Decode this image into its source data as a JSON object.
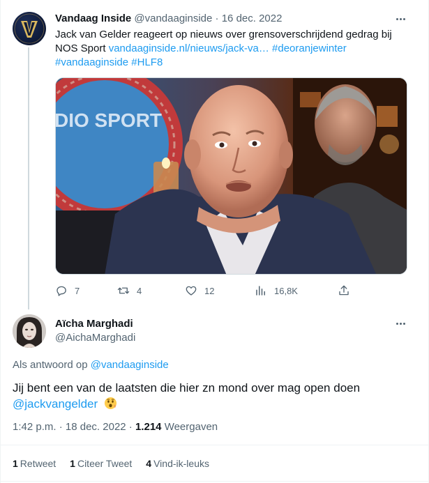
{
  "original_tweet": {
    "display_name": "Vandaag Inside",
    "handle": "@vandaaginside",
    "separator": " · ",
    "date": "16 dec. 2022",
    "text_plain": "Jack van Gelder reageert op nieuws over grensoverschrijdend gedrag bij NOS Sport ",
    "link": "vandaaginside.nl/nieuws/jack-va…",
    "hashtag_1": "#deoranjewinter",
    "hashtag_2": "#vandaaginside",
    "hashtag_3": "#HLF8",
    "avatar_letter": "V",
    "media_studio_text": "DIO SPORT",
    "actions": {
      "reply_count": "7",
      "retweet_count": "4",
      "like_count": "12",
      "view_count": "16,8K"
    }
  },
  "reply_tweet": {
    "display_name": "Aïcha Marghadi",
    "handle": "@AichaMarghadi",
    "replying_prefix": "Als antwoord op ",
    "replying_to": "@vandaaginside",
    "text": "Jij bent een van de laatsten die hier zn mond over mag open doen",
    "mention": "@jackvangelder",
    "emoji": "hushed-face",
    "time": "1:42 p.m.",
    "date": "18 dec. 2022",
    "views_count": "1.214",
    "views_label": "Weergaven",
    "stats": {
      "retweet_count": "1",
      "retweet_label": "Retweet",
      "quote_count": "1",
      "quote_label": "Citeer Tweet",
      "like_count": "4",
      "like_label": "Vind-ik-leuks"
    }
  },
  "colors": {
    "link": "#1d9bf0",
    "secondary_text": "#536471",
    "primary_text": "#0f1419",
    "divider": "#eff3f4"
  },
  "icons": [
    "more-icon",
    "reply-icon",
    "retweet-icon",
    "like-icon",
    "views-icon",
    "share-icon",
    "hushed-face-emoji"
  ]
}
